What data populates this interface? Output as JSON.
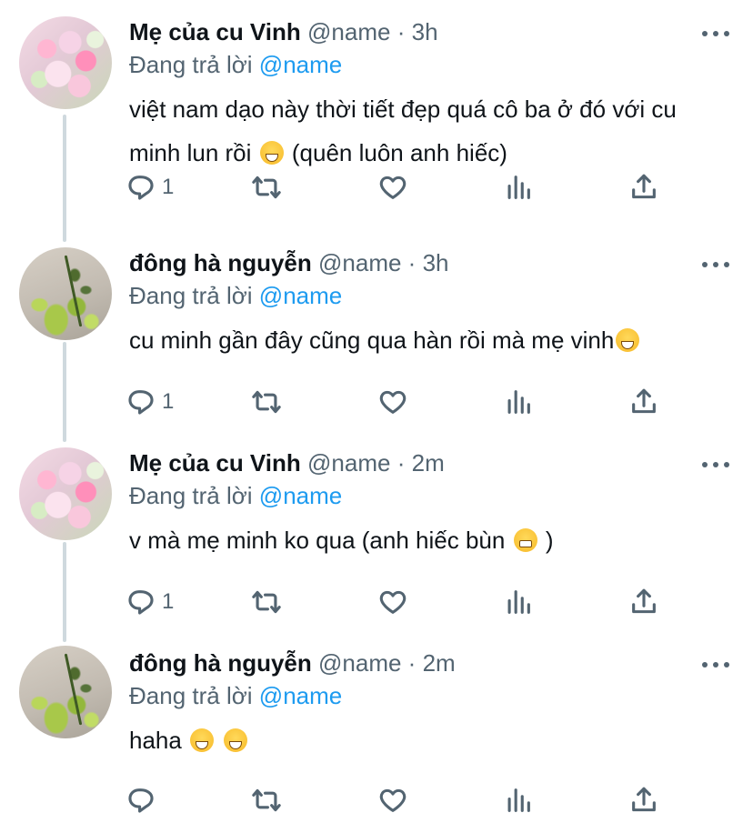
{
  "tweets": [
    {
      "display_name": "Mẹ của cu Vinh",
      "handle": "@name",
      "separator": "·",
      "time": "3h",
      "reply_prefix": "Đang trả lời",
      "reply_to": "@name",
      "text_1": "việt nam dạo này thời tiết đẹp quá cô ba ở đó với cu minh lun rồi",
      "text_2": " (quên luôn anh hiếc)",
      "reply_count": "1",
      "avatar": "flowers"
    },
    {
      "display_name": "đông hà nguyễn",
      "handle": "@name",
      "separator": "·",
      "time": "3h",
      "reply_prefix": "Đang trả lời",
      "reply_to": "@name",
      "text_1": "cu minh gần đây cũng qua hàn rồi mà mẹ vinh",
      "text_2": "",
      "reply_count": "1",
      "avatar": "plant"
    },
    {
      "display_name": "Mẹ của cu Vinh",
      "handle": "@name",
      "separator": "·",
      "time": "2m",
      "reply_prefix": "Đang trả lời",
      "reply_to": "@name",
      "text_1": "v mà mẹ minh ko qua (anh hiếc bùn",
      "text_2": " )",
      "reply_count": "1",
      "avatar": "flowers"
    },
    {
      "display_name": "đông hà nguyễn",
      "handle": "@name",
      "separator": "·",
      "time": "2m",
      "reply_prefix": "Đang trả lời",
      "reply_to": "@name",
      "text_1": "haha",
      "text_2": "",
      "reply_count": "",
      "avatar": "plant"
    }
  ],
  "icons": {
    "reply": "reply-icon",
    "retweet": "retweet-icon",
    "like": "heart-icon",
    "views": "views-icon",
    "share": "share-icon",
    "more": "more-icon"
  },
  "colors": {
    "link": "#1d9bf0",
    "secondary_text": "#536471",
    "primary_text": "#0f1419",
    "thread_line": "#cfd9de"
  }
}
